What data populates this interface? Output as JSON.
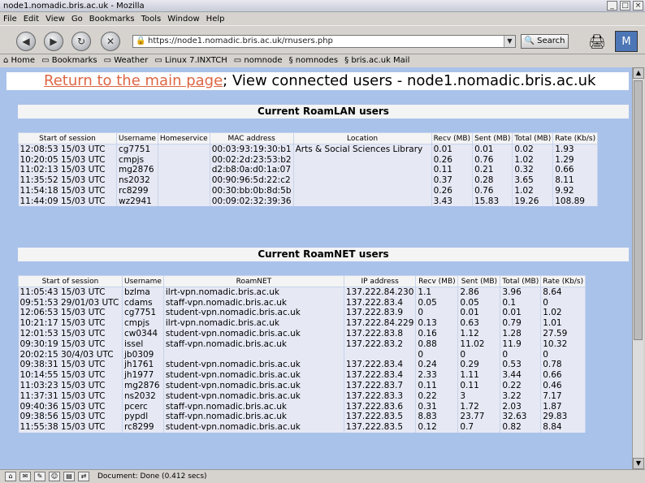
{
  "window": {
    "title": "node1.nomadic.bris.ac.uk - Mozilla"
  },
  "menu": [
    "File",
    "Edit",
    "View",
    "Go",
    "Bookmarks",
    "Tools",
    "Window",
    "Help"
  ],
  "nav": {
    "url": "https://node1.nomadic.bris.ac.uk/rnusers.php",
    "search_label": "Search"
  },
  "bookmarks": [
    "Home",
    "Bookmarks",
    "Weather",
    "Linux 7.INXTCH",
    "nomnode",
    "nomnodes",
    "bris.ac.uk Mail"
  ],
  "page": {
    "link_text": "Return to the main page",
    "title_text": "; View connected users - node1.nomadic.bris.ac.uk"
  },
  "roamlan": {
    "title": "Current RoamLAN users",
    "headers": [
      "Start of session",
      "Username",
      "Homeservice",
      "MAC address",
      "Location",
      "Recv (MB)",
      "Sent (MB)",
      "Total (MB)",
      "Rate (Kb/s)"
    ],
    "rows": [
      [
        "12:08:53 15/03 UTC",
        "cg7751",
        "",
        "00:03:93:19:30:b1",
        "Arts & Social Sciences Library",
        "0.01",
        "0.01",
        "0.02",
        "1.93"
      ],
      [
        "10:20:05 15/03 UTC",
        "cmpjs",
        "",
        "00:02:2d:23:53:b2",
        "",
        "0.26",
        "0.76",
        "1.02",
        "1.29"
      ],
      [
        "11:02:13 15/03 UTC",
        "mg2876",
        "",
        "d2:b8:0a:d0:1a:07",
        "",
        "0.11",
        "0.21",
        "0.32",
        "0.66"
      ],
      [
        "11:35:52 15/03 UTC",
        "ns2032",
        "",
        "00:90:96:5d:22:c2",
        "",
        "0.37",
        "0.28",
        "3.65",
        "8.11"
      ],
      [
        "11:54:18 15/03 UTC",
        "rc8299",
        "",
        "00:30:bb:0b:8d:5b",
        "",
        "0.26",
        "0.76",
        "1.02",
        "9.92"
      ],
      [
        "11:44:09 15/03 UTC",
        "wz2941",
        "",
        "00:09:02:32:39:36",
        "",
        "3.43",
        "15.83",
        "19.26",
        "108.89"
      ]
    ]
  },
  "roamnet": {
    "title": "Current RoamNET users",
    "headers": [
      "Start of session",
      "Username",
      "RoamNET",
      "IP address",
      "Recv (MB)",
      "Sent (MB)",
      "Total (MB)",
      "Rate (Kb/s)"
    ],
    "rows": [
      [
        "11:05:43 15/03 UTC",
        "bzlma",
        "ilrt-vpn.nomadic.bris.ac.uk",
        "137.222.84.230",
        "1.1",
        "2.86",
        "3.96",
        "8.64"
      ],
      [
        "09:51:53 29/01/03 UTC",
        "cdams",
        "staff-vpn.nomadic.bris.ac.uk",
        "137.222.83.4",
        "0.05",
        "0.05",
        "0.1",
        "0"
      ],
      [
        "12:06:53 15/03 UTC",
        "cg7751",
        "student-vpn.nomadic.bris.ac.uk",
        "137.222.83.9",
        "0",
        "0.01",
        "0.01",
        "1.02"
      ],
      [
        "10:21:17 15/03 UTC",
        "cmpjs",
        "ilrt-vpn.nomadic.bris.ac.uk",
        "137.222.84.229",
        "0.13",
        "0.63",
        "0.79",
        "1.01"
      ],
      [
        "12:01:53 15/03 UTC",
        "cw0344",
        "student-vpn.nomadic.bris.ac.uk",
        "137.222.83.8",
        "0.16",
        "1.12",
        "1.28",
        "27.59"
      ],
      [
        "09:30:19 15/03 UTC",
        "issel",
        "staff-vpn.nomadic.bris.ac.uk",
        "137.222.83.2",
        "0.88",
        "11.02",
        "11.9",
        "10.32"
      ],
      [
        "20:02:15 30/4/03 UTC",
        "jb0309",
        "",
        "",
        "0",
        "0",
        "0",
        "0"
      ],
      [
        "09:38:31 15/03 UTC",
        "jh1761",
        "student-vpn.nomadic.bris.ac.uk",
        "137.222.83.4",
        "0.24",
        "0.29",
        "0.53",
        "0.78"
      ],
      [
        "10:14:55 15/03 UTC",
        "jh1977",
        "student-vpn.nomadic.bris.ac.uk",
        "137.222.83.4",
        "2.33",
        "1.11",
        "3.44",
        "0.66"
      ],
      [
        "11:03:23 15/03 UTC",
        "mg2876",
        "student-vpn.nomadic.bris.ac.uk",
        "137.222.83.7",
        "0.11",
        "0.11",
        "0.22",
        "0.46"
      ],
      [
        "11:37:31 15/03 UTC",
        "ns2032",
        "student-vpn.nomadic.bris.ac.uk",
        "137.222.83.3",
        "0.22",
        "3",
        "3.22",
        "7.17"
      ],
      [
        "09:40:36 15/03 UTC",
        "pcerc",
        "staff-vpn.nomadic.bris.ac.uk",
        "137.222.83.6",
        "0.31",
        "1.72",
        "2.03",
        "1.87"
      ],
      [
        "09:38:56 15/03 UTC",
        "pypdl",
        "staff-vpn.nomadic.bris.ac.uk",
        "137.222.83.5",
        "8.83",
        "23.77",
        "32.63",
        "29.83"
      ],
      [
        "11:55:38 15/03 UTC",
        "rc8299",
        "student-vpn.nomadic.bris.ac.uk",
        "137.222.83.5",
        "0.12",
        "0.7",
        "0.82",
        "8.84"
      ]
    ]
  },
  "status": {
    "text": "Document: Done (0.412 secs)"
  }
}
